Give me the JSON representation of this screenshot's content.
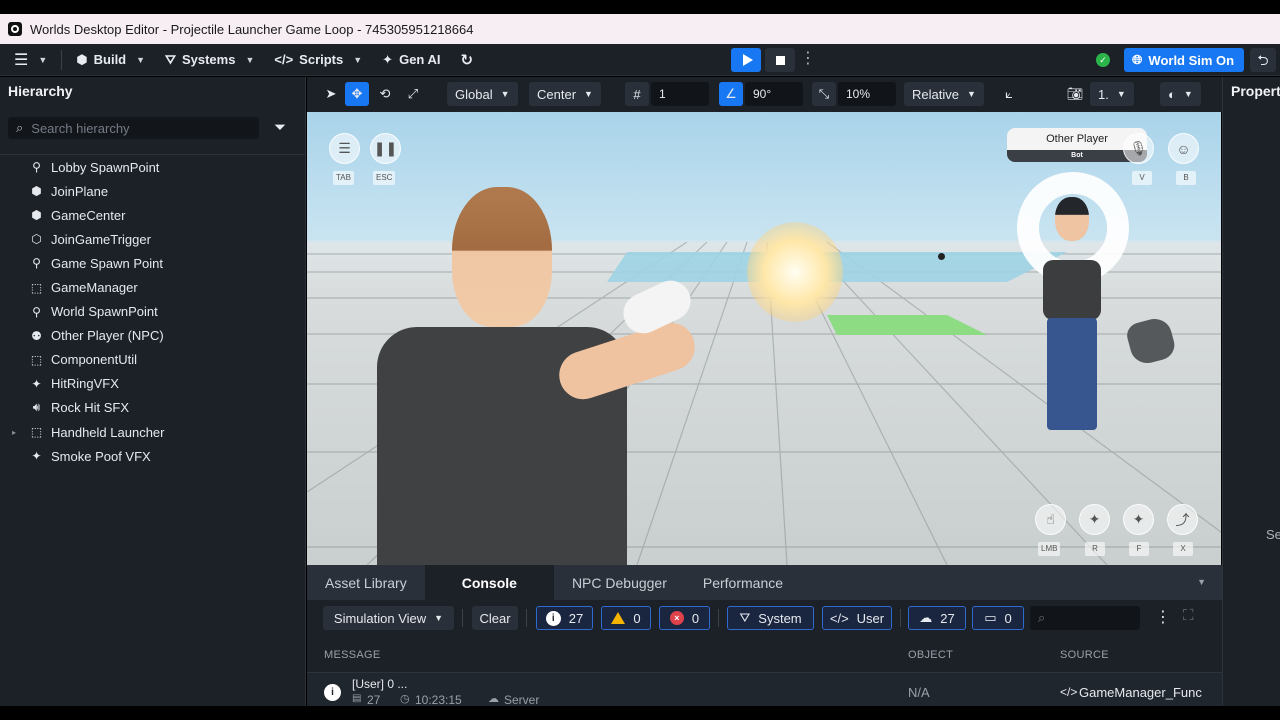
{
  "window": {
    "title": "Worlds Desktop Editor - Projectile Launcher Game Loop - 745305951218664"
  },
  "menubar": {
    "build_label": "Build",
    "systems_label": "Systems",
    "scripts_label": "Scripts",
    "genai_label": "Gen AI",
    "worldsim_label": "World Sim On"
  },
  "hierarchy": {
    "title": "Hierarchy",
    "search_placeholder": "Search hierarchy",
    "items": [
      {
        "label": "Lobby SpawnPoint",
        "icon": "spawn-icon"
      },
      {
        "label": "JoinPlane",
        "icon": "mesh-icon"
      },
      {
        "label": "GameCenter",
        "icon": "mesh-icon"
      },
      {
        "label": "JoinGameTrigger",
        "icon": "trigger-icon"
      },
      {
        "label": "Game  Spawn Point",
        "icon": "spawn-icon"
      },
      {
        "label": "GameManager",
        "icon": "empty-object-icon"
      },
      {
        "label": "World SpawnPoint",
        "icon": "spawn-icon"
      },
      {
        "label": "Other Player (NPC)",
        "icon": "npc-icon"
      },
      {
        "label": "ComponentUtil",
        "icon": "empty-object-icon"
      },
      {
        "label": "HitRingVFX",
        "icon": "sparkle-icon"
      },
      {
        "label": "Rock Hit SFX",
        "icon": "sound-icon"
      },
      {
        "label": "Handheld Launcher",
        "icon": "empty-object-icon"
      },
      {
        "label": "Smoke Poof VFX",
        "icon": "sparkle-icon"
      }
    ]
  },
  "toolbar": {
    "space_label": "Global",
    "pivot_label": "Center",
    "grid_value": "1",
    "rotation_snap": "90°",
    "scale_snap": "10%",
    "mode_label": "Relative",
    "camera_value": "1."
  },
  "viewport": {
    "tab_key": "TAB",
    "esc_key": "ESC",
    "other_player_name": "Other Player",
    "other_player_tag": "Bot",
    "v_key": "V",
    "b_key": "B",
    "lmb_key": "LMB",
    "r_key": "R",
    "f_key": "F",
    "x_key": "X"
  },
  "right_panel": {
    "title": "Properties",
    "partial": "Se"
  },
  "console": {
    "tabs": [
      "Asset Library",
      "Console",
      "NPC Debugger",
      "Performance"
    ],
    "active_tab": "Console",
    "view_label": "Simulation View",
    "clear_label": "Clear",
    "info_count": "27",
    "warning_count": "0",
    "error_count": "0",
    "system_label": "System",
    "user_label": "User",
    "cloud_count": "27",
    "local_count": "0",
    "columns": {
      "message": "MESSAGE",
      "object": "OBJECT",
      "source": "SOURCE"
    },
    "rows": [
      {
        "message": "[User] 0 ...",
        "count": "27",
        "time": "10:23:15",
        "origin": "Server",
        "object": "N/A",
        "source": "GameManager_Func"
      }
    ]
  },
  "colors": {
    "accent": "#1877f2",
    "panel": "#1c2128",
    "ok": "#2bb44a"
  }
}
